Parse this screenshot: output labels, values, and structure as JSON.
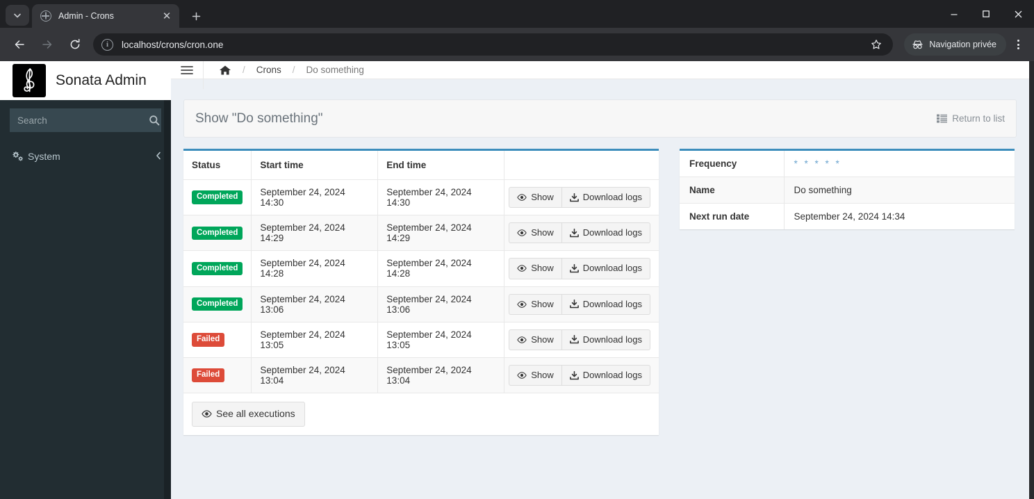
{
  "browser": {
    "tab": {
      "title": "Admin - Crons",
      "favicon_icon": "globe-icon",
      "close_icon": "close-icon"
    },
    "tab_list_icon": "chevron-down-icon",
    "new_tab_icon": "plus-icon",
    "back_icon": "arrow-left-icon",
    "forward_icon": "arrow-right-icon",
    "reload_icon": "reload-icon",
    "site_info_icon": "info-icon",
    "url": "localhost/crons/cron.one",
    "bookmark_icon": "star-icon",
    "incognito_label": "Navigation privée",
    "incognito_icon": "incognito-icon",
    "menu_icon": "three-dots-icon",
    "minimize_icon": "minimize-icon",
    "maximize_icon": "maximize-icon",
    "close_window_icon": "close-icon"
  },
  "app": {
    "brand": "Sonata Admin",
    "brand_logo_icon": "treble-clef-icon",
    "toggle_icon": "hamburger-icon",
    "breadcrumb": {
      "home_icon": "home-icon",
      "sep": "/",
      "items": [
        {
          "label": "Crons"
        },
        {
          "label": "Do something"
        }
      ]
    }
  },
  "sidebar": {
    "search": {
      "value": "",
      "placeholder": "Search",
      "icon": "search-icon"
    },
    "items": [
      {
        "label": "System",
        "icon": "cogs-icon",
        "arrow_icon": "chevron-left-icon"
      }
    ]
  },
  "main": {
    "page_title": "Show \"Do something\"",
    "return_to_list": {
      "label": "Return to list",
      "icon": "list-icon"
    },
    "executions": {
      "columns": [
        "Status",
        "Start time",
        "End time",
        ""
      ],
      "rows": [
        {
          "status": "Completed",
          "status_type": "completed",
          "start": "September 24, 2024 14:30",
          "end": "September 24, 2024 14:30",
          "show": "Show",
          "download": "Download logs"
        },
        {
          "status": "Completed",
          "status_type": "completed",
          "start": "September 24, 2024 14:29",
          "end": "September 24, 2024 14:29",
          "show": "Show",
          "download": "Download logs"
        },
        {
          "status": "Completed",
          "status_type": "completed",
          "start": "September 24, 2024 14:28",
          "end": "September 24, 2024 14:28",
          "show": "Show",
          "download": "Download logs"
        },
        {
          "status": "Completed",
          "status_type": "completed",
          "start": "September 24, 2024 13:06",
          "end": "September 24, 2024 13:06",
          "show": "Show",
          "download": "Download logs"
        },
        {
          "status": "Failed",
          "status_type": "failed",
          "start": "September 24, 2024 13:05",
          "end": "September 24, 2024 13:05",
          "show": "Show",
          "download": "Download logs"
        },
        {
          "status": "Failed",
          "status_type": "failed",
          "start": "September 24, 2024 13:04",
          "end": "September 24, 2024 13:04",
          "show": "Show",
          "download": "Download logs"
        }
      ],
      "see_all": {
        "label": "See all executions",
        "icon": "eye-icon"
      },
      "show_icon": "eye-icon",
      "download_icon": "download-icon"
    },
    "details": {
      "rows": [
        {
          "key": "Frequency",
          "value": "* * * * *",
          "is_cron": true
        },
        {
          "key": "Name",
          "value": "Do something",
          "is_cron": false
        },
        {
          "key": "Next run date",
          "value": "September 24, 2024 14:34",
          "is_cron": false
        }
      ]
    }
  },
  "colors": {
    "accent": "#3c8dbc",
    "success": "#00a65a",
    "danger": "#dd4b39",
    "sidebar_bg": "#222d32",
    "content_bg": "#ecf0f5"
  }
}
